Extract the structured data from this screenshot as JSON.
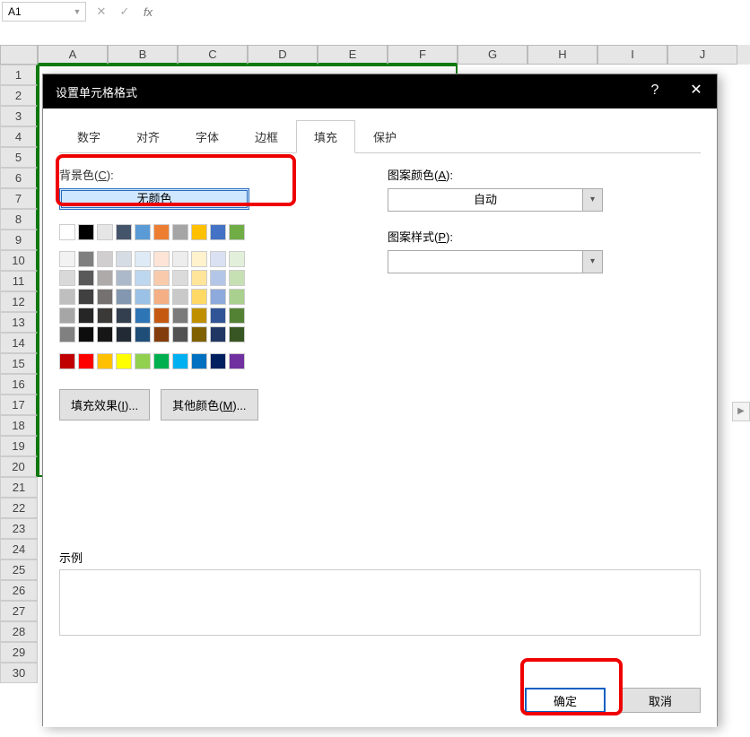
{
  "nameBox": "A1",
  "fx_symbols": {
    "cancel": "✕",
    "confirm": "✓",
    "fx": "fx"
  },
  "columns": [
    "A",
    "B",
    "C",
    "D",
    "E",
    "F",
    "G",
    "H",
    "I",
    "J"
  ],
  "rows": [
    1,
    2,
    3,
    4,
    5,
    6,
    7,
    8,
    9,
    10,
    11,
    12,
    13,
    14,
    15,
    16,
    17,
    18,
    19,
    20,
    21,
    22,
    23,
    24,
    25,
    26,
    27,
    28,
    29,
    30
  ],
  "dialog": {
    "title": "设置单元格格式",
    "help": "?",
    "close": "✕",
    "tabs": [
      "数字",
      "对齐",
      "字体",
      "边框",
      "填充",
      "保护"
    ],
    "activeTab": 4,
    "bgColorLabelPre": "背景色(",
    "bgColorLabelKey": "C",
    "bgColorLabelPost": "):",
    "noColor": "无颜色",
    "fillEffectsPre": "填充效果(",
    "fillEffectsKey": "I",
    "fillEffectsPost": ")...",
    "moreColorsPre": "其他颜色(",
    "moreColorsKey": "M",
    "moreColorsPost": ")...",
    "patternColorPre": "图案颜色(",
    "patternColorKey": "A",
    "patternColorPost": "):",
    "patternColorValue": "自动",
    "patternStylePre": "图案样式(",
    "patternStyleKey": "P",
    "patternStylePost": "):",
    "patternStyleValue": "",
    "sampleLabel": "示例",
    "okLabel": "确定",
    "cancelLabel": "取消"
  },
  "colors": {
    "row0": [
      "#FFFFFF",
      "#000000",
      "#E7E6E6",
      "#44546A",
      "#5B9BD5",
      "#ED7D31",
      "#A5A5A5",
      "#FFC000",
      "#4472C4",
      "#70AD47"
    ],
    "rowsTheme": [
      [
        "#F2F2F2",
        "#7F7F7F",
        "#D0CECE",
        "#D6DCE4",
        "#DEEBF6",
        "#FCE4D6",
        "#EDEDED",
        "#FFF2CC",
        "#D9E1F2",
        "#E2EFDA"
      ],
      [
        "#D9D9D9",
        "#595959",
        "#AEAAAA",
        "#ACB9CA",
        "#BDD7EE",
        "#F8CBAD",
        "#DBDBDB",
        "#FFE599",
        "#B4C6E7",
        "#C6E0B4"
      ],
      [
        "#BFBFBF",
        "#404040",
        "#767171",
        "#8497B0",
        "#9BC2E6",
        "#F4B084",
        "#C9C9C9",
        "#FFD966",
        "#8EA9DB",
        "#A9D08E"
      ],
      [
        "#A6A6A6",
        "#262626",
        "#3B3838",
        "#333F4F",
        "#2E75B6",
        "#C65911",
        "#7B7B7B",
        "#BF8F00",
        "#305496",
        "#548235"
      ],
      [
        "#808080",
        "#0D0D0D",
        "#161616",
        "#222B35",
        "#1F4E78",
        "#833C0C",
        "#525252",
        "#806000",
        "#203764",
        "#375623"
      ]
    ],
    "standard": [
      "#C00000",
      "#FF0000",
      "#FFC000",
      "#FFFF00",
      "#92D050",
      "#00B050",
      "#00B0F0",
      "#0070C0",
      "#002060",
      "#7030A0"
    ]
  }
}
